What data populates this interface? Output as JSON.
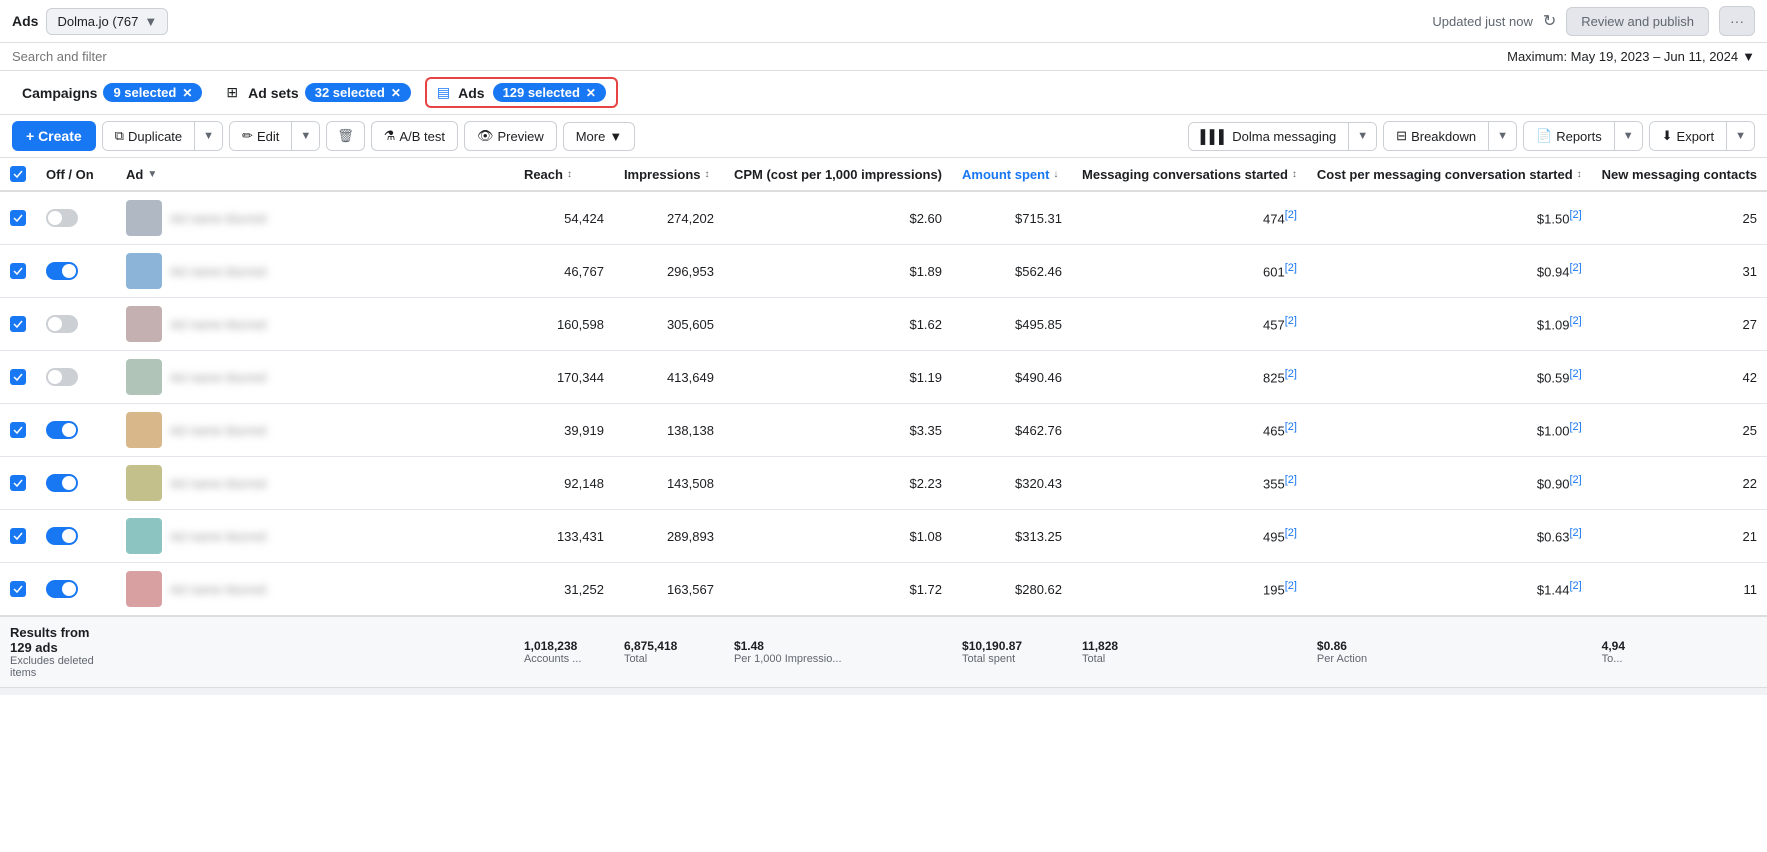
{
  "topbar": {
    "ads_label": "Ads",
    "account": "Dolma.jo (767",
    "updated_text": "Updated just now",
    "review_publish": "Review and publish",
    "more_dots": "···"
  },
  "search": {
    "placeholder": "Search and filter",
    "date_range": "Maximum: May 19, 2023 – Jun 11, 2024"
  },
  "filters": {
    "campaigns_label": "Campaigns",
    "campaigns_badge": "9 selected",
    "adsets_label": "Ad sets",
    "adsets_badge": "32 selected",
    "ads_label": "Ads",
    "ads_badge": "129 selected"
  },
  "toolbar": {
    "create": "+ Create",
    "duplicate": "Duplicate",
    "edit": "Edit",
    "delete": "🗑",
    "ab_test": "A/B test",
    "preview": "Preview",
    "more": "More",
    "dolma_messaging": "Dolma messaging",
    "breakdown": "Breakdown",
    "reports": "Reports",
    "export": "Export"
  },
  "columns": {
    "off_on": "Off / On",
    "ad": "Ad",
    "reach": "Reach",
    "impressions": "Impressions",
    "cpm": "CPM (cost per 1,000 impressions)",
    "amount_spent": "Amount spent",
    "messaging_conversations": "Messaging conversations started",
    "cost_per_messaging": "Cost per messaging conversation started",
    "new_messaging": "New messaging contacts"
  },
  "rows": [
    {
      "checked": true,
      "on": false,
      "reach": "54,424",
      "impressions": "274,202",
      "cpm": "$2.60",
      "amount_spent": "$715.31",
      "conversations": "474",
      "cost_conv": "$1.50",
      "new_contacts": "25"
    },
    {
      "checked": true,
      "on": true,
      "reach": "46,767",
      "impressions": "296,953",
      "cpm": "$1.89",
      "amount_spent": "$562.46",
      "conversations": "601",
      "cost_conv": "$0.94",
      "new_contacts": "31"
    },
    {
      "checked": true,
      "on": false,
      "reach": "160,598",
      "impressions": "305,605",
      "cpm": "$1.62",
      "amount_spent": "$495.85",
      "conversations": "457",
      "cost_conv": "$1.09",
      "new_contacts": "27"
    },
    {
      "checked": true,
      "on": false,
      "reach": "170,344",
      "impressions": "413,649",
      "cpm": "$1.19",
      "amount_spent": "$490.46",
      "conversations": "825",
      "cost_conv": "$0.59",
      "new_contacts": "42"
    },
    {
      "checked": true,
      "on": true,
      "reach": "39,919",
      "impressions": "138,138",
      "cpm": "$3.35",
      "amount_spent": "$462.76",
      "conversations": "465",
      "cost_conv": "$1.00",
      "new_contacts": "25"
    },
    {
      "checked": true,
      "on": true,
      "reach": "92,148",
      "impressions": "143,508",
      "cpm": "$2.23",
      "amount_spent": "$320.43",
      "conversations": "355",
      "cost_conv": "$0.90",
      "new_contacts": "22"
    },
    {
      "checked": true,
      "on": true,
      "reach": "133,431",
      "impressions": "289,893",
      "cpm": "$1.08",
      "amount_spent": "$313.25",
      "conversations": "495",
      "cost_conv": "$0.63",
      "new_contacts": "21"
    },
    {
      "checked": true,
      "on": true,
      "reach": "31,252",
      "impressions": "163,567",
      "cpm": "$1.72",
      "amount_spent": "$280.62",
      "conversations": "195",
      "cost_conv": "$1.44",
      "new_contacts": "11"
    }
  ],
  "footer": {
    "label": "Results from 129 ads",
    "sub": "Excludes deleted items",
    "reach": "1,018,238",
    "reach_sub": "Accounts ...",
    "impressions": "6,875,418",
    "impressions_sub": "Total",
    "cpm": "$1.48",
    "cpm_sub": "Per 1,000 Impressio...",
    "amount_spent": "$10,190.87",
    "amount_spent_sub": "Total spent",
    "conversations": "11,828",
    "conversations_sub": "Total",
    "cost_conv": "$0.86",
    "cost_conv_sub": "Per Action",
    "new_contacts": "4,94",
    "new_contacts_sub": "To..."
  }
}
